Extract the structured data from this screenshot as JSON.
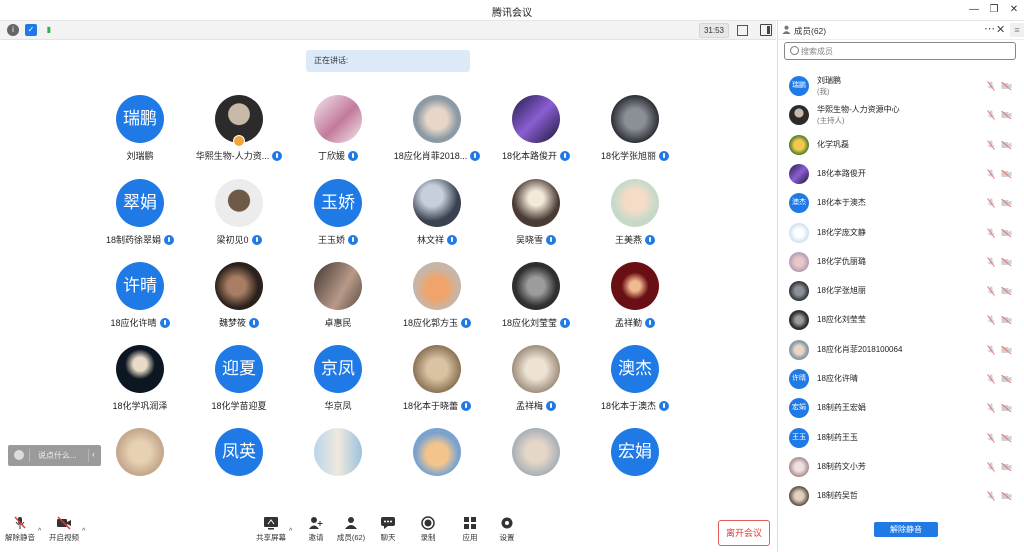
{
  "window": {
    "title": "腾讯会议"
  },
  "topbar": {
    "timer": "31:53"
  },
  "speaking": {
    "label": "正在讲话:"
  },
  "grid": {
    "tiles": [
      {
        "name": "刘瑞鹏",
        "avatar_text": "瑞鹏",
        "mic": false,
        "host": false
      },
      {
        "name": "华熙生物-人力资...",
        "avatar_text": "",
        "mic": true,
        "host": true,
        "img": "g1"
      },
      {
        "name": "丁欣媛",
        "avatar_text": "",
        "mic": true,
        "host": false,
        "img": "g2"
      },
      {
        "name": "18应化肖菲2018...",
        "avatar_text": "",
        "mic": true,
        "host": false,
        "img": "g3"
      },
      {
        "name": "18化本路俊开",
        "avatar_text": "",
        "mic": true,
        "host": false,
        "img": "g4"
      },
      {
        "name": "18化学张旭丽",
        "avatar_text": "",
        "mic": true,
        "host": false,
        "img": "g5"
      },
      {
        "name": "18制药徐翠娟",
        "avatar_text": "翠娟",
        "mic": true,
        "host": false
      },
      {
        "name": "梁初见0",
        "avatar_text": "",
        "mic": true,
        "host": false,
        "img": "g6"
      },
      {
        "name": "王玉娇",
        "avatar_text": "玉娇",
        "mic": true,
        "host": false
      },
      {
        "name": "林文祥",
        "avatar_text": "",
        "mic": true,
        "host": false,
        "img": "g7"
      },
      {
        "name": "吴晓雪",
        "avatar_text": "",
        "mic": true,
        "host": false,
        "img": "g8"
      },
      {
        "name": "王美燕",
        "avatar_text": "",
        "mic": true,
        "host": false,
        "img": "g9"
      },
      {
        "name": "18应化许晴",
        "avatar_text": "许晴",
        "mic": true,
        "host": false
      },
      {
        "name": "魏梦筱",
        "avatar_text": "",
        "mic": true,
        "host": false,
        "img": "g10"
      },
      {
        "name": "卓惠民",
        "avatar_text": "",
        "mic": false,
        "host": false,
        "img": "g11"
      },
      {
        "name": "18应化郭方玉",
        "avatar_text": "",
        "mic": true,
        "host": false,
        "img": "g12"
      },
      {
        "name": "18应化刘莹莹",
        "avatar_text": "",
        "mic": true,
        "host": false,
        "img": "g13"
      },
      {
        "name": "孟祥勤",
        "avatar_text": "",
        "mic": true,
        "host": false,
        "img": "g14"
      },
      {
        "name": "18化学巩润泽",
        "avatar_text": "",
        "mic": false,
        "host": false,
        "img": "g15"
      },
      {
        "name": "18化学苗迎夏",
        "avatar_text": "迎夏",
        "mic": false,
        "host": false
      },
      {
        "name": "华京凤",
        "avatar_text": "京凤",
        "mic": false,
        "host": false
      },
      {
        "name": "18化本于晓蕾",
        "avatar_text": "",
        "mic": true,
        "host": false,
        "img": "g16"
      },
      {
        "name": "孟祥梅",
        "avatar_text": "",
        "mic": true,
        "host": false,
        "img": "g17"
      },
      {
        "name": "18化本于澳杰",
        "avatar_text": "澳杰",
        "mic": true,
        "host": false
      },
      {
        "name": "",
        "avatar_text": "",
        "mic": false,
        "host": false,
        "img": "g18"
      },
      {
        "name": "",
        "avatar_text": "凤英",
        "mic": false,
        "host": false
      },
      {
        "name": "",
        "avatar_text": "",
        "mic": false,
        "host": false,
        "img": "g19"
      },
      {
        "name": "",
        "avatar_text": "",
        "mic": false,
        "host": false,
        "img": "g20"
      },
      {
        "name": "",
        "avatar_text": "",
        "mic": false,
        "host": false,
        "img": "g21"
      },
      {
        "name": "",
        "avatar_text": "宏娟",
        "mic": false,
        "host": false
      }
    ]
  },
  "chat_input": {
    "placeholder": "说点什么..."
  },
  "bottombar": {
    "unmute": "解除静音",
    "start_video": "开启视频",
    "share_screen": "共享屏幕",
    "invite": "邀请",
    "members": "成员(62)",
    "chat": "聊天",
    "record": "录制",
    "apps": "应用",
    "settings": "设置",
    "leave": "离开会议"
  },
  "sidebar": {
    "title": "成员(62)",
    "search_placeholder": "搜索成员",
    "members": [
      {
        "name": "刘瑞鹏",
        "sub": "(我)",
        "avatar_text": "瑞鹏"
      },
      {
        "name": "华熙生物-人力资源中心",
        "sub": "(主持人)",
        "avatar_text": "",
        "img": "g1"
      },
      {
        "name": "化学巩磊",
        "sub": "",
        "avatar_text": "",
        "img": "s1"
      },
      {
        "name": "18化本路俊开",
        "sub": "",
        "avatar_text": "",
        "img": "g4"
      },
      {
        "name": "18化本于澳杰",
        "sub": "",
        "avatar_text": "澳杰"
      },
      {
        "name": "18化学庞文静",
        "sub": "",
        "avatar_text": "",
        "img": "s2"
      },
      {
        "name": "18化学仇丽璐",
        "sub": "",
        "avatar_text": "",
        "img": "s3"
      },
      {
        "name": "18化学张旭丽",
        "sub": "",
        "avatar_text": "",
        "img": "g5"
      },
      {
        "name": "18应化刘莹莹",
        "sub": "",
        "avatar_text": "",
        "img": "g13"
      },
      {
        "name": "18应化肖菲2018100064",
        "sub": "",
        "avatar_text": "",
        "img": "g3"
      },
      {
        "name": "18应化许晴",
        "sub": "",
        "avatar_text": "许晴"
      },
      {
        "name": "18制药王宏娟",
        "sub": "",
        "avatar_text": "宏娟"
      },
      {
        "name": "18制药王玉",
        "sub": "",
        "avatar_text": "王玉"
      },
      {
        "name": "18制药文小芳",
        "sub": "",
        "avatar_text": "",
        "img": "s4"
      },
      {
        "name": "18制药吴哲",
        "sub": "",
        "avatar_text": "",
        "img": "s5"
      }
    ],
    "unmute_all": "解除静音"
  },
  "colors": {
    "accent": "#1f7ae6",
    "leave": "#e03b3b"
  }
}
